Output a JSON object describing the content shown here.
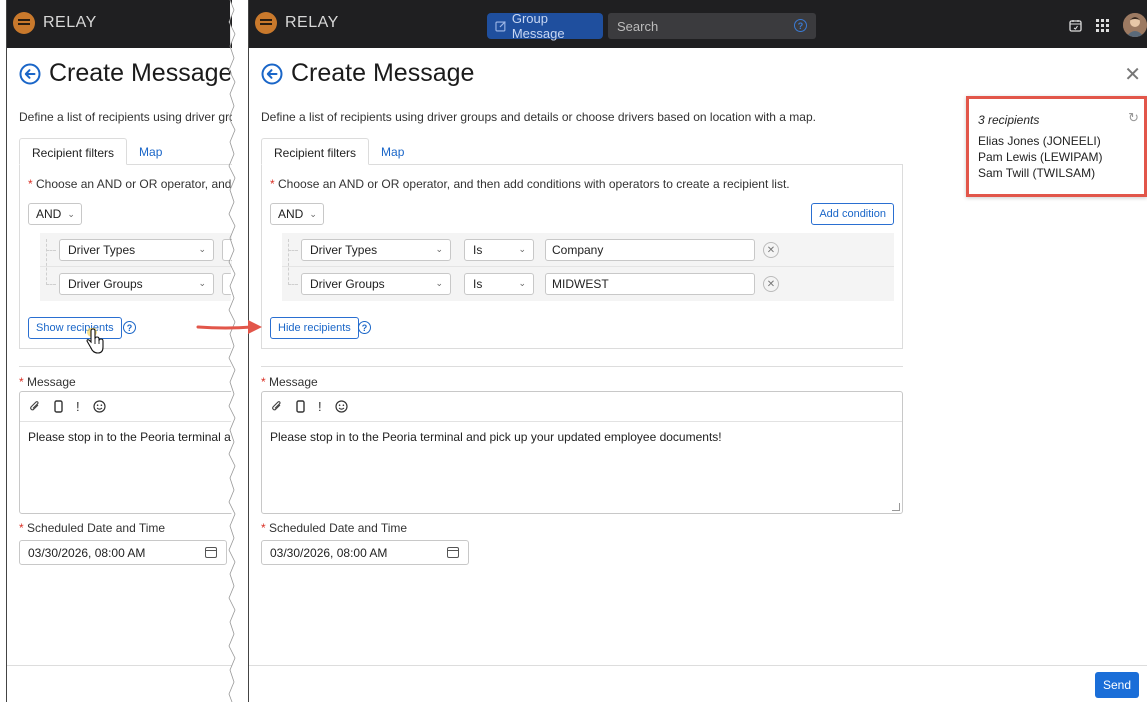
{
  "app": {
    "name": "RELAY"
  },
  "header": {
    "group_message_label": "Group Message",
    "search_placeholder": "Search"
  },
  "page": {
    "title": "Create Message",
    "description": "Define a list of recipients using driver groups and details or choose drivers based on location with a map."
  },
  "tabs": [
    {
      "label": "Recipient filters",
      "active": true
    },
    {
      "label": "Map",
      "active": false
    }
  ],
  "filters": {
    "required_note": "Choose an AND or OR operator, and then add conditions with operators to create a recipient list.",
    "operator": "AND",
    "add_condition_label": "Add condition",
    "conditions": [
      {
        "field": "Driver Types",
        "operator": "Is",
        "value": "Company"
      },
      {
        "field": "Driver Groups",
        "operator": "Is",
        "value": "MIDWEST"
      }
    ],
    "show_recipients_label": "Show recipients",
    "hide_recipients_label": "Hide recipients"
  },
  "message": {
    "label": "Message",
    "toolbar": {
      "attach": "attach-icon",
      "device": "device-icon",
      "priority": "!",
      "emoji": "emoji-icon"
    },
    "text": "Please stop in to the Peoria terminal and pick up your updated employee documents!"
  },
  "schedule": {
    "label": "Scheduled Date and Time",
    "value": "03/30/2026, 08:00 AM"
  },
  "send_label": "Send",
  "recipients": {
    "count_label": "3 recipients",
    "list": [
      "Elias Jones (JONEELI)",
      "Pam Lewis (LEWIPAM)",
      "Sam Twill (TWILSAM)"
    ]
  },
  "glyphs": {
    "required": "*",
    "chevron": "⌄",
    "remove": "✕",
    "close": "✕",
    "help": "?",
    "refresh": "↻"
  },
  "colors": {
    "accent": "#1a66c8",
    "topbar": "#1f1f21",
    "highlight": "#e2564a",
    "send": "#1a6ed8"
  }
}
